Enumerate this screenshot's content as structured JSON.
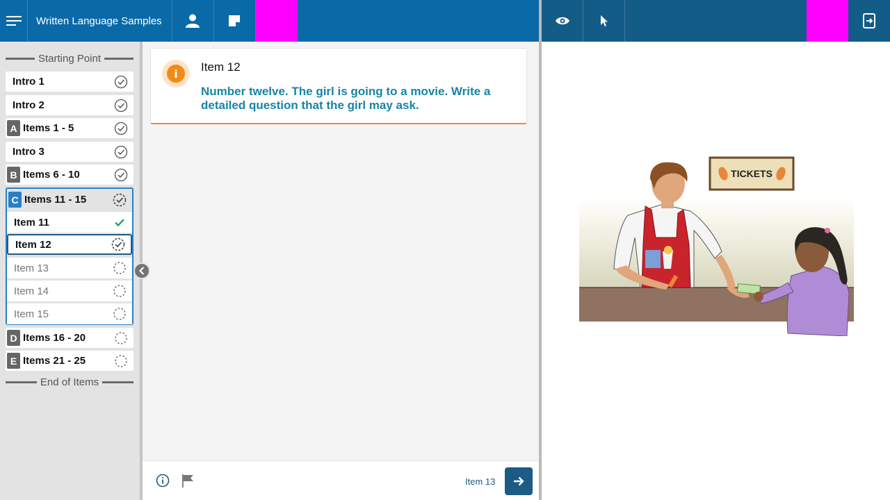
{
  "header": {
    "title": "Written Language Samples",
    "colors": {
      "primary": "#0a6aa8",
      "secondary": "#145c88",
      "highlight": "#ff00ff"
    },
    "left_icons": [
      "menu-icon",
      "user-icon",
      "note-icon"
    ],
    "right_icons": [
      "eye-icon",
      "pointer-icon",
      "exit-icon"
    ]
  },
  "sidebar": {
    "start_label": "Starting Point",
    "end_label": "End of Items",
    "items": [
      {
        "label": "Intro 1",
        "status": "complete"
      },
      {
        "label": "Intro 2",
        "status": "complete"
      },
      {
        "section": "A",
        "label": "Items 1 - 5",
        "status": "complete"
      },
      {
        "label": "Intro 3",
        "status": "complete"
      },
      {
        "section": "B",
        "label": "Items 6 - 10",
        "status": "complete"
      },
      {
        "section": "C",
        "label": "Items 11 - 15",
        "status": "in-progress"
      },
      {
        "section": "D",
        "label": "Items 16 - 20",
        "status": "not-started"
      },
      {
        "section": "E",
        "label": "Items 21 - 25",
        "status": "not-started"
      }
    ],
    "expanded_group": {
      "items": [
        {
          "label": "Item 11",
          "status": "done"
        },
        {
          "label": "Item 12",
          "status": "current"
        },
        {
          "label": "Item 13",
          "status": "pending"
        },
        {
          "label": "Item 14",
          "status": "pending"
        },
        {
          "label": "Item 15",
          "status": "pending"
        }
      ]
    }
  },
  "main": {
    "card": {
      "title": "Item 12",
      "prompt": "Number twelve. The girl is going to a movie. Write a detailed question that the girl may ask."
    },
    "footer": {
      "next_label": "Item 13"
    }
  },
  "illustration": {
    "sign_text": "TICKETS"
  }
}
